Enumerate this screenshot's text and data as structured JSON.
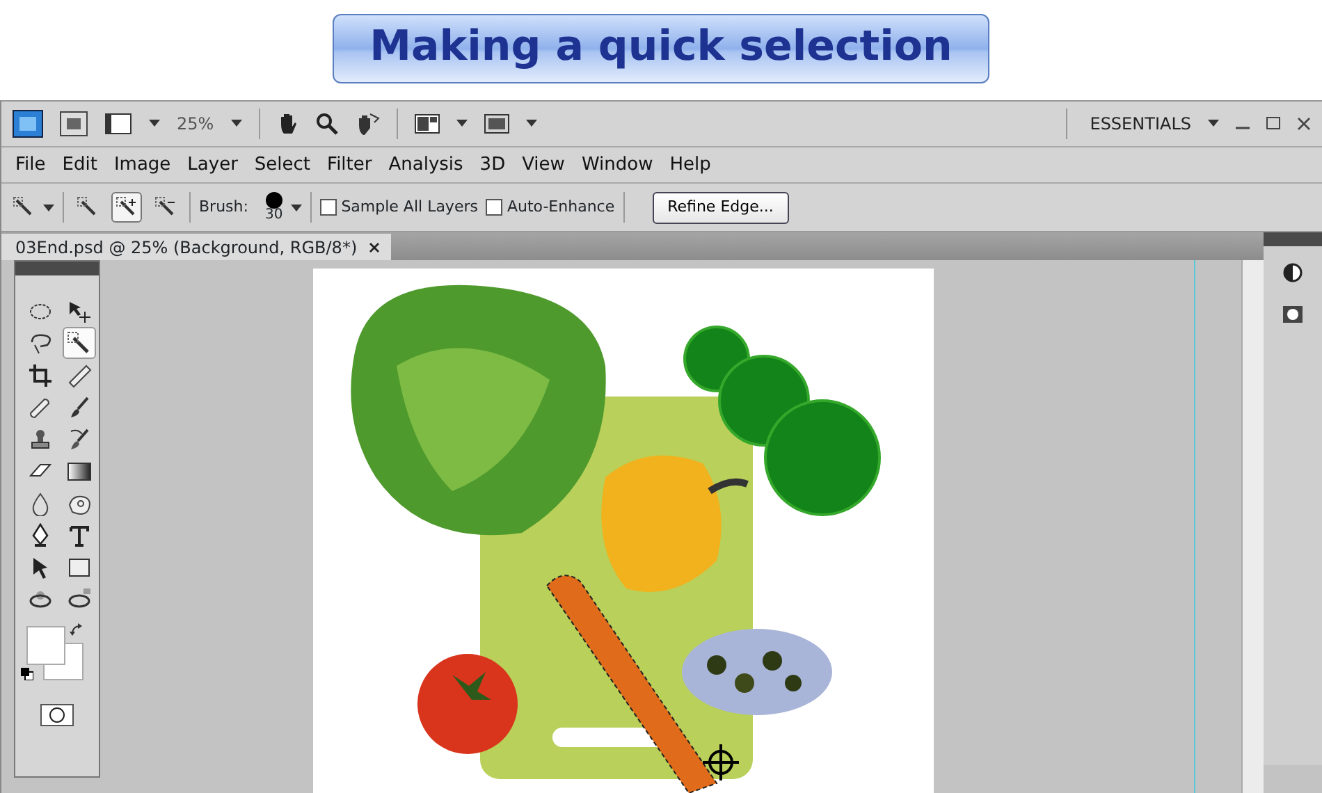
{
  "banner": {
    "title": "Making a quick selection"
  },
  "app_bar": {
    "zoom": "25%",
    "workspace": "ESSENTIALS"
  },
  "menu": [
    "File",
    "Edit",
    "Image",
    "Layer",
    "Select",
    "Filter",
    "Analysis",
    "3D",
    "View",
    "Window",
    "Help"
  ],
  "options_bar": {
    "tool_modes": [
      {
        "selected": false
      },
      {
        "selected": true
      },
      {
        "selected": false
      }
    ],
    "brush_label": "Brush:",
    "brush_size": "30",
    "checkboxes": [
      {
        "label": "Sample All Layers",
        "checked": false
      },
      {
        "label": "Auto-Enhance",
        "checked": false
      }
    ],
    "refine_button": "Refine Edge..."
  },
  "document_tab": {
    "title": "03End.psd @ 25% (Background, RGB/8*)"
  },
  "tools": [
    {
      "selected": false
    },
    {
      "selected": false
    },
    {
      "selected": false
    },
    {
      "selected": true
    },
    {
      "selected": false
    },
    {
      "selected": false
    },
    {
      "selected": false
    },
    {
      "selected": false
    },
    {
      "selected": false
    },
    {
      "selected": false
    },
    {
      "selected": false
    },
    {
      "selected": false
    },
    {
      "selected": false
    },
    {
      "selected": false
    },
    {
      "selected": false
    },
    {
      "selected": false
    },
    {
      "selected": false
    },
    {
      "selected": false
    },
    {
      "selected": false
    },
    {
      "selected": false
    }
  ]
}
